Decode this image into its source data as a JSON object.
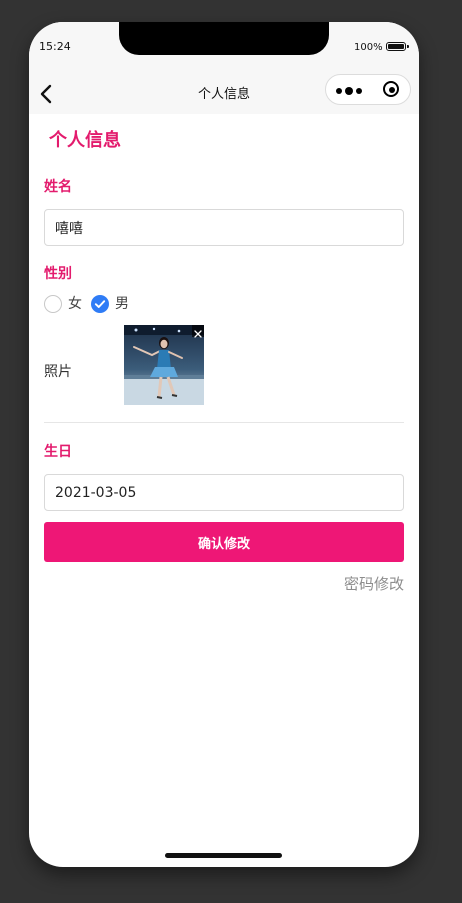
{
  "status_bar": {
    "time": "15:24",
    "battery": "100%"
  },
  "nav": {
    "title": "个人信息",
    "back_icon": "chevron-left-icon",
    "more_icon": "more-dots-icon",
    "close_icon": "target-circle-icon"
  },
  "page": {
    "heading": "个人信息"
  },
  "form": {
    "name_label": "姓名",
    "name_value": "嘻嘻",
    "gender_label": "性别",
    "gender_options": [
      {
        "label": "女",
        "selected": false
      },
      {
        "label": "男",
        "selected": true
      }
    ],
    "photo_label": "照片",
    "photo_alt": "photo of a figure skater",
    "birthday_label": "生日",
    "birthday_value": "2021-03-05",
    "confirm_label": "确认修改",
    "password_link": "密码修改"
  },
  "colors": {
    "accent": "#e31b6d",
    "button": "#ee1776",
    "radio_selected": "#2f7cf6",
    "link": "#8d8d8d"
  }
}
